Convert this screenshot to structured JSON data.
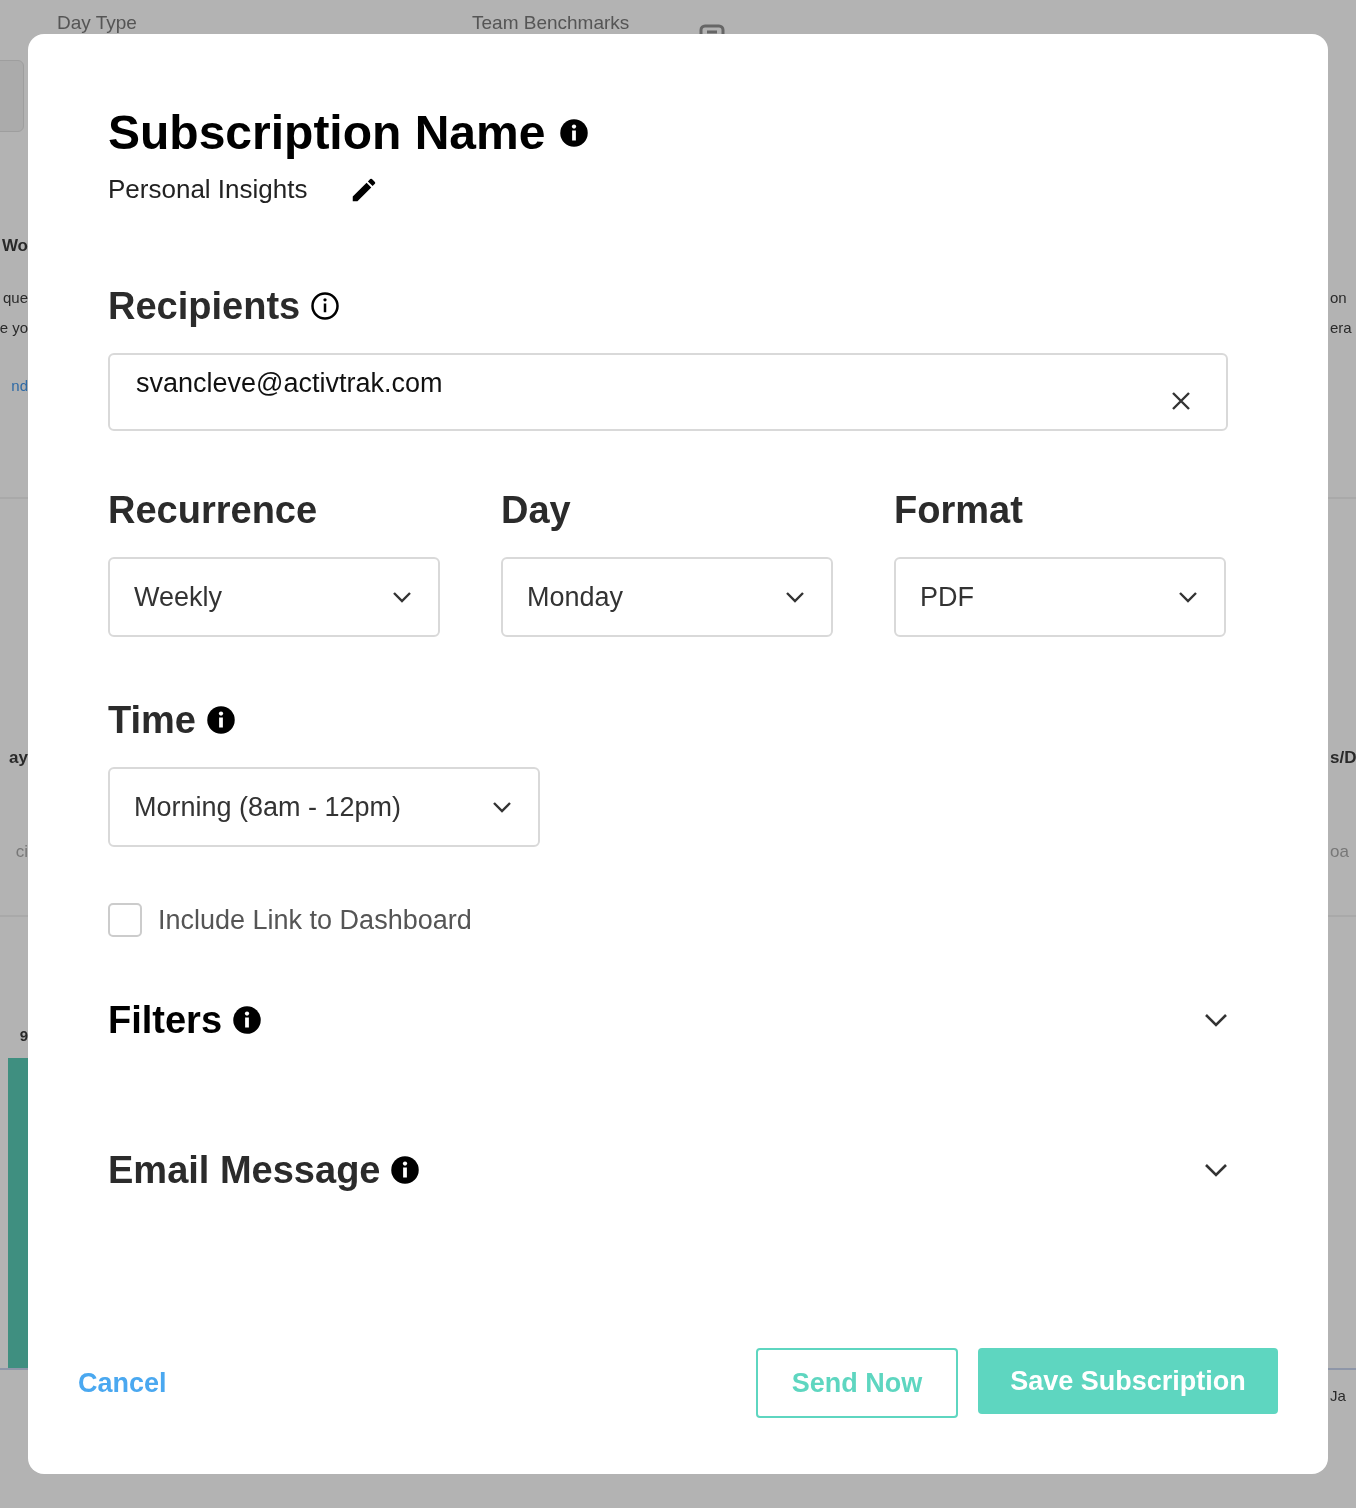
{
  "background": {
    "labels": [
      "Day Type",
      "Team Benchmarks"
    ],
    "left_fragments": [
      {
        "kind": "heading",
        "text": "Wo"
      },
      {
        "kind": "text",
        "text": "que"
      },
      {
        "kind": "text",
        "text": "e yo"
      },
      {
        "kind": "link",
        "text": "nd"
      },
      {
        "kind": "heading",
        "text": "ay"
      },
      {
        "kind": "muted",
        "text": "ci"
      },
      {
        "kind": "value",
        "text": "9"
      }
    ],
    "right_fragments": [
      {
        "kind": "text",
        "text": "on"
      },
      {
        "kind": "text",
        "text": "era"
      },
      {
        "kind": "heading",
        "text": "s/D"
      },
      {
        "kind": "muted",
        "text": "oa"
      },
      {
        "kind": "text",
        "text": "Ja"
      }
    ]
  },
  "dialog": {
    "title": "Subscription Name",
    "subscription_name": "Personal Insights",
    "recipients_label": "Recipients",
    "recipients": [
      "svancleve@activtrak.com"
    ],
    "selects": [
      {
        "label": "Recurrence",
        "value": "Weekly"
      },
      {
        "label": "Day",
        "value": "Monday"
      },
      {
        "label": "Format",
        "value": "PDF"
      }
    ],
    "time": {
      "label": "Time",
      "value": "Morning (8am - 12pm)"
    },
    "include_link": {
      "label": "Include Link to Dashboard",
      "checked": false
    },
    "sections": [
      {
        "title": "Filters",
        "expanded": false
      },
      {
        "title": "Email Message",
        "expanded": false
      }
    ],
    "buttons": {
      "cancel": "Cancel",
      "send_now": "Send Now",
      "save": "Save Subscription"
    }
  }
}
